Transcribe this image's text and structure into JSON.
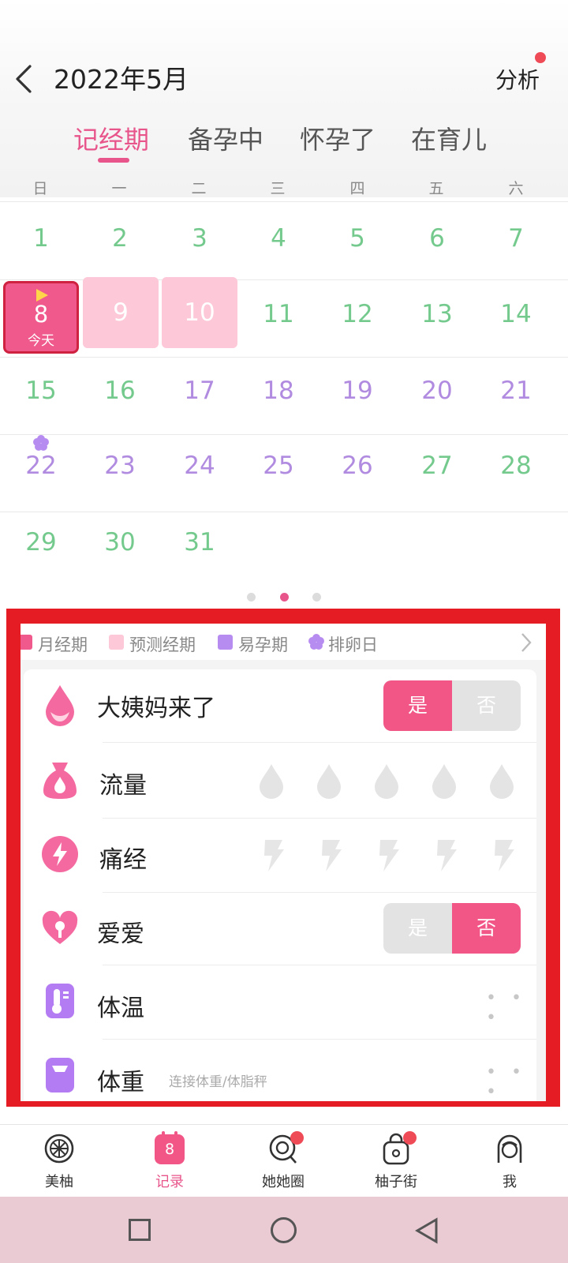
{
  "header": {
    "title": "2022年5月",
    "analysis_label": "分析"
  },
  "tabs": [
    {
      "label": "记经期",
      "active": true
    },
    {
      "label": "备孕中",
      "active": false
    },
    {
      "label": "怀孕了",
      "active": false
    },
    {
      "label": "在育儿",
      "active": false
    }
  ],
  "weekdays": [
    "日",
    "一",
    "二",
    "三",
    "四",
    "五",
    "六"
  ],
  "calendar": {
    "today": {
      "day": "8",
      "label": "今天"
    },
    "days": [
      "1",
      "2",
      "3",
      "4",
      "5",
      "6",
      "7",
      "8",
      "9",
      "10",
      "11",
      "12",
      "13",
      "14",
      "15",
      "16",
      "17",
      "18",
      "19",
      "20",
      "21",
      "22",
      "23",
      "24",
      "25",
      "26",
      "27",
      "28",
      "29",
      "30",
      "31"
    ]
  },
  "legend": [
    {
      "label": "月经期",
      "color": "#f0598c"
    },
    {
      "label": "预测经期",
      "color": "#fdc8d7"
    },
    {
      "label": "易孕期",
      "color": "#b78cf0"
    },
    {
      "label": "排卵日",
      "color": "#b78cf0"
    }
  ],
  "records": {
    "period_came": {
      "label": "大姨妈来了",
      "yes": "是",
      "no": "否",
      "selected": "是"
    },
    "flow": {
      "label": "流量"
    },
    "pain": {
      "label": "痛经"
    },
    "love": {
      "label": "爱爱",
      "yes": "是",
      "no": "否",
      "selected": "否"
    },
    "temperature": {
      "label": "体温"
    },
    "weight": {
      "label": "体重",
      "sub": "连接体重/体脂秤"
    }
  },
  "bottom_nav": [
    {
      "label": "美柚",
      "active": false,
      "icon": "grapefruit-icon"
    },
    {
      "label": "记录",
      "active": true,
      "icon": "calendar-icon",
      "badge_text": "8"
    },
    {
      "label": "她她圈",
      "active": false,
      "icon": "chat-icon",
      "dot": true
    },
    {
      "label": "柚子街",
      "active": false,
      "icon": "shopping-bag-icon",
      "dot": true
    },
    {
      "label": "我",
      "active": false,
      "icon": "profile-icon"
    }
  ],
  "colors": {
    "accent": "#e8558b",
    "fertile": "#b08be0",
    "safe": "#74c98d",
    "frame": "#e61c24"
  }
}
